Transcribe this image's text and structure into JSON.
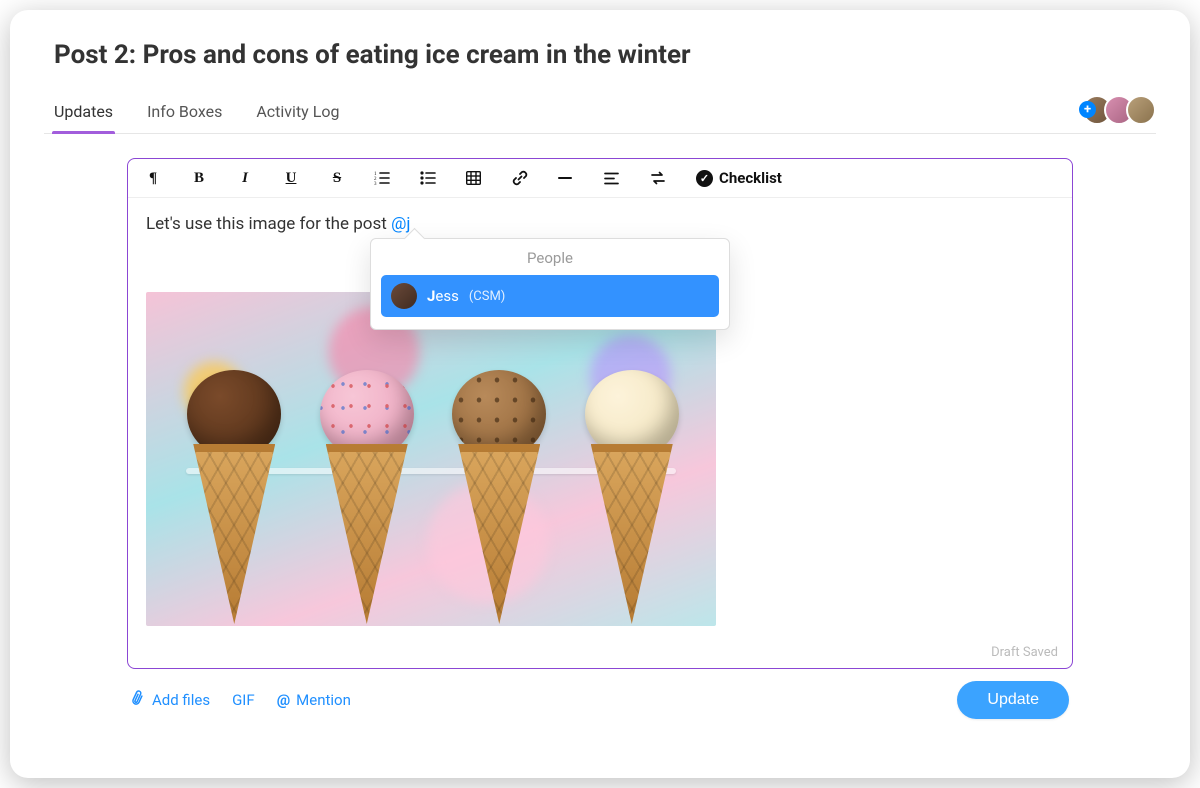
{
  "page": {
    "title": "Post 2: Pros and cons of eating ice cream in the winter"
  },
  "tabs": {
    "t0": "Updates",
    "t1": "Info Boxes",
    "t2": "Activity Log",
    "activeIndex": 0
  },
  "avatars": {
    "add_icon": "plus-icon",
    "list": [
      {
        "name": "avatar-1"
      },
      {
        "name": "avatar-2"
      },
      {
        "name": "avatar-3"
      }
    ]
  },
  "toolbar": {
    "icons": {
      "paragraph": "paragraph-icon",
      "bold": "bold-icon",
      "italic": "italic-icon",
      "underline": "underline-icon",
      "strike": "strikethrough-icon",
      "ol": "ordered-list-icon",
      "ul": "unordered-list-icon",
      "table": "table-icon",
      "link": "link-icon",
      "hr": "horizontal-rule-icon",
      "align": "align-icon",
      "indent": "indent-swap-icon"
    },
    "checklist_label": "Checklist"
  },
  "editor": {
    "text_before_mention": "Let's use this image for the post ",
    "mention_typed": "@j",
    "draft_status": "Draft Saved",
    "attached_image_alt": "ice-cream-cones-image"
  },
  "mention_popup": {
    "header": "People",
    "items": [
      {
        "name_bold": "J",
        "name_rest": "ess",
        "role": "(CSM)"
      }
    ]
  },
  "footer": {
    "add_files": "Add files",
    "gif": "GIF",
    "mention": "Mention",
    "update_button": "Update"
  }
}
